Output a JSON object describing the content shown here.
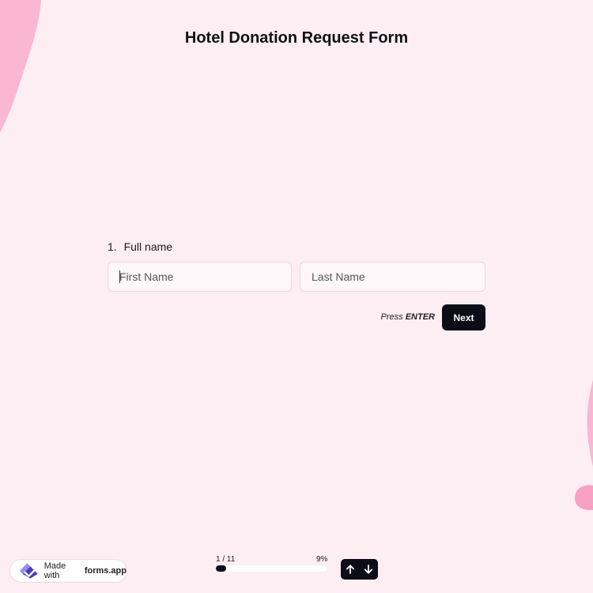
{
  "form": {
    "title": "Hotel Donation Request Form"
  },
  "question": {
    "number": "1.",
    "label": "Full name",
    "first_name_placeholder": "First Name",
    "last_name_placeholder": "Last Name",
    "first_name_value": "",
    "last_name_value": ""
  },
  "actions": {
    "press_label": "Press",
    "enter_label": "ENTER",
    "next_label": "Next"
  },
  "footer": {
    "badge_prefix": "Made with",
    "badge_brand": "forms.app",
    "progress_count": "1 / 11",
    "progress_percent_label": "9%",
    "progress_fraction": 0.09
  },
  "icons": {
    "nav_up": "arrow-up-icon",
    "nav_down": "arrow-down-icon",
    "brand": "forms-app-logo-icon"
  },
  "colors": {
    "background": "#fdeef4",
    "accent_pink": "#f9a8c9",
    "button_dark": "#0d0d17",
    "input_bg": "#fff7fa"
  }
}
